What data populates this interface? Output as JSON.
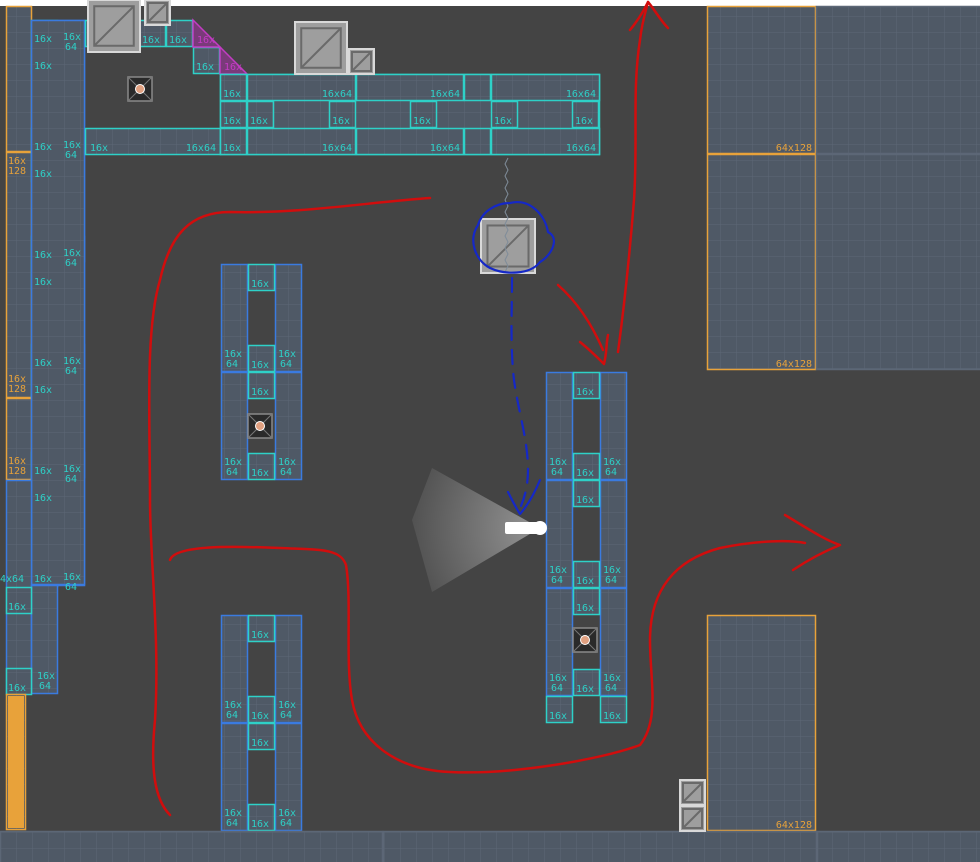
{
  "colors": {
    "background": "#444444",
    "cyan": "#2ed1c8",
    "blue": "#3a7be0",
    "orange": "#e8a23a",
    "magenta": "#c33cc4",
    "cell_fill": "#4f5966",
    "red": "#d10d0d",
    "ink_blue": "#1528c7"
  },
  "labels": {
    "t16": "16x",
    "t64": "64",
    "t16x64": "16x64",
    "t128": "128",
    "t64x128": "64x128",
    "t4x64": "4x64"
  },
  "entities": {
    "player": "player-flashlight",
    "crate": "crate-icon",
    "turret": "turret-icon"
  }
}
